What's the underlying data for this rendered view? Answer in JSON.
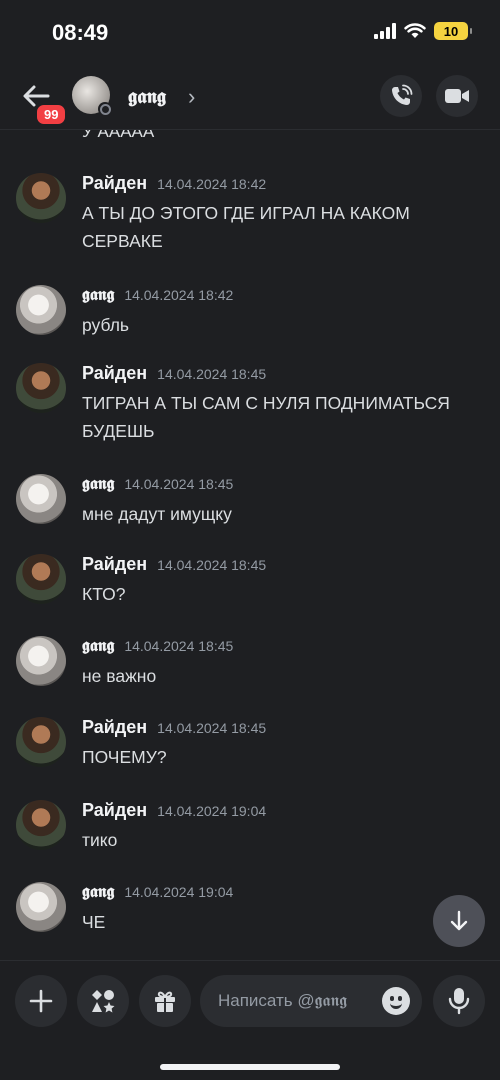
{
  "status_bar": {
    "time": "08:49",
    "battery": "10"
  },
  "header": {
    "unread_count": "99",
    "channel_name": "𝖌𝖆𝖓𝖌",
    "chevron": "›"
  },
  "previous_message_fragment": "У ААААА",
  "messages": [
    {
      "author": "Райден",
      "author_type": "rayden",
      "timestamp": "14.04.2024 18:42",
      "text": "А ТЫ ДО ЭТОГО ГДЕ ИГРАЛ НА КАКОМ СЕРВАКЕ"
    },
    {
      "author": "𝖌𝖆𝖓𝖌",
      "author_type": "gang",
      "timestamp": "14.04.2024 18:42",
      "text": "рубль"
    },
    {
      "author": "Райден",
      "author_type": "rayden",
      "timestamp": "14.04.2024 18:45",
      "text": "ТИГРАН А ТЫ САМ С НУЛЯ ПОДНИМАТЬСЯ БУДЕШЬ"
    },
    {
      "author": "𝖌𝖆𝖓𝖌",
      "author_type": "gang",
      "timestamp": "14.04.2024 18:45",
      "text": "мне дадут имущку"
    },
    {
      "author": "Райден",
      "author_type": "rayden",
      "timestamp": "14.04.2024 18:45",
      "text": "КТО?"
    },
    {
      "author": "𝖌𝖆𝖓𝖌",
      "author_type": "gang",
      "timestamp": "14.04.2024 18:45",
      "text": "не важно"
    },
    {
      "author": "Райден",
      "author_type": "rayden",
      "timestamp": "14.04.2024 18:45",
      "text": "ПОЧЕМУ?"
    },
    {
      "author": "Райден",
      "author_type": "rayden",
      "timestamp": "14.04.2024 19:04",
      "text": "тико"
    },
    {
      "author": "𝖌𝖆𝖓𝖌",
      "author_type": "gang",
      "timestamp": "14.04.2024 19:04",
      "text": "ЧЕ"
    }
  ],
  "composer": {
    "placeholder": "Написать @𝖌𝖆𝖓𝖌"
  },
  "icons": {
    "back": "arrow-left-icon",
    "call": "phone-call-icon",
    "video": "video-camera-icon",
    "scroll": "arrow-down-icon",
    "plus": "plus-icon",
    "apps": "apps-icon",
    "gift": "gift-icon",
    "emoji": "emoji-icon",
    "mic": "microphone-icon"
  },
  "colors": {
    "background": "#1e1f22",
    "badge": "#f23f43",
    "battery": "#f5d340",
    "surface": "#2b2d31"
  }
}
